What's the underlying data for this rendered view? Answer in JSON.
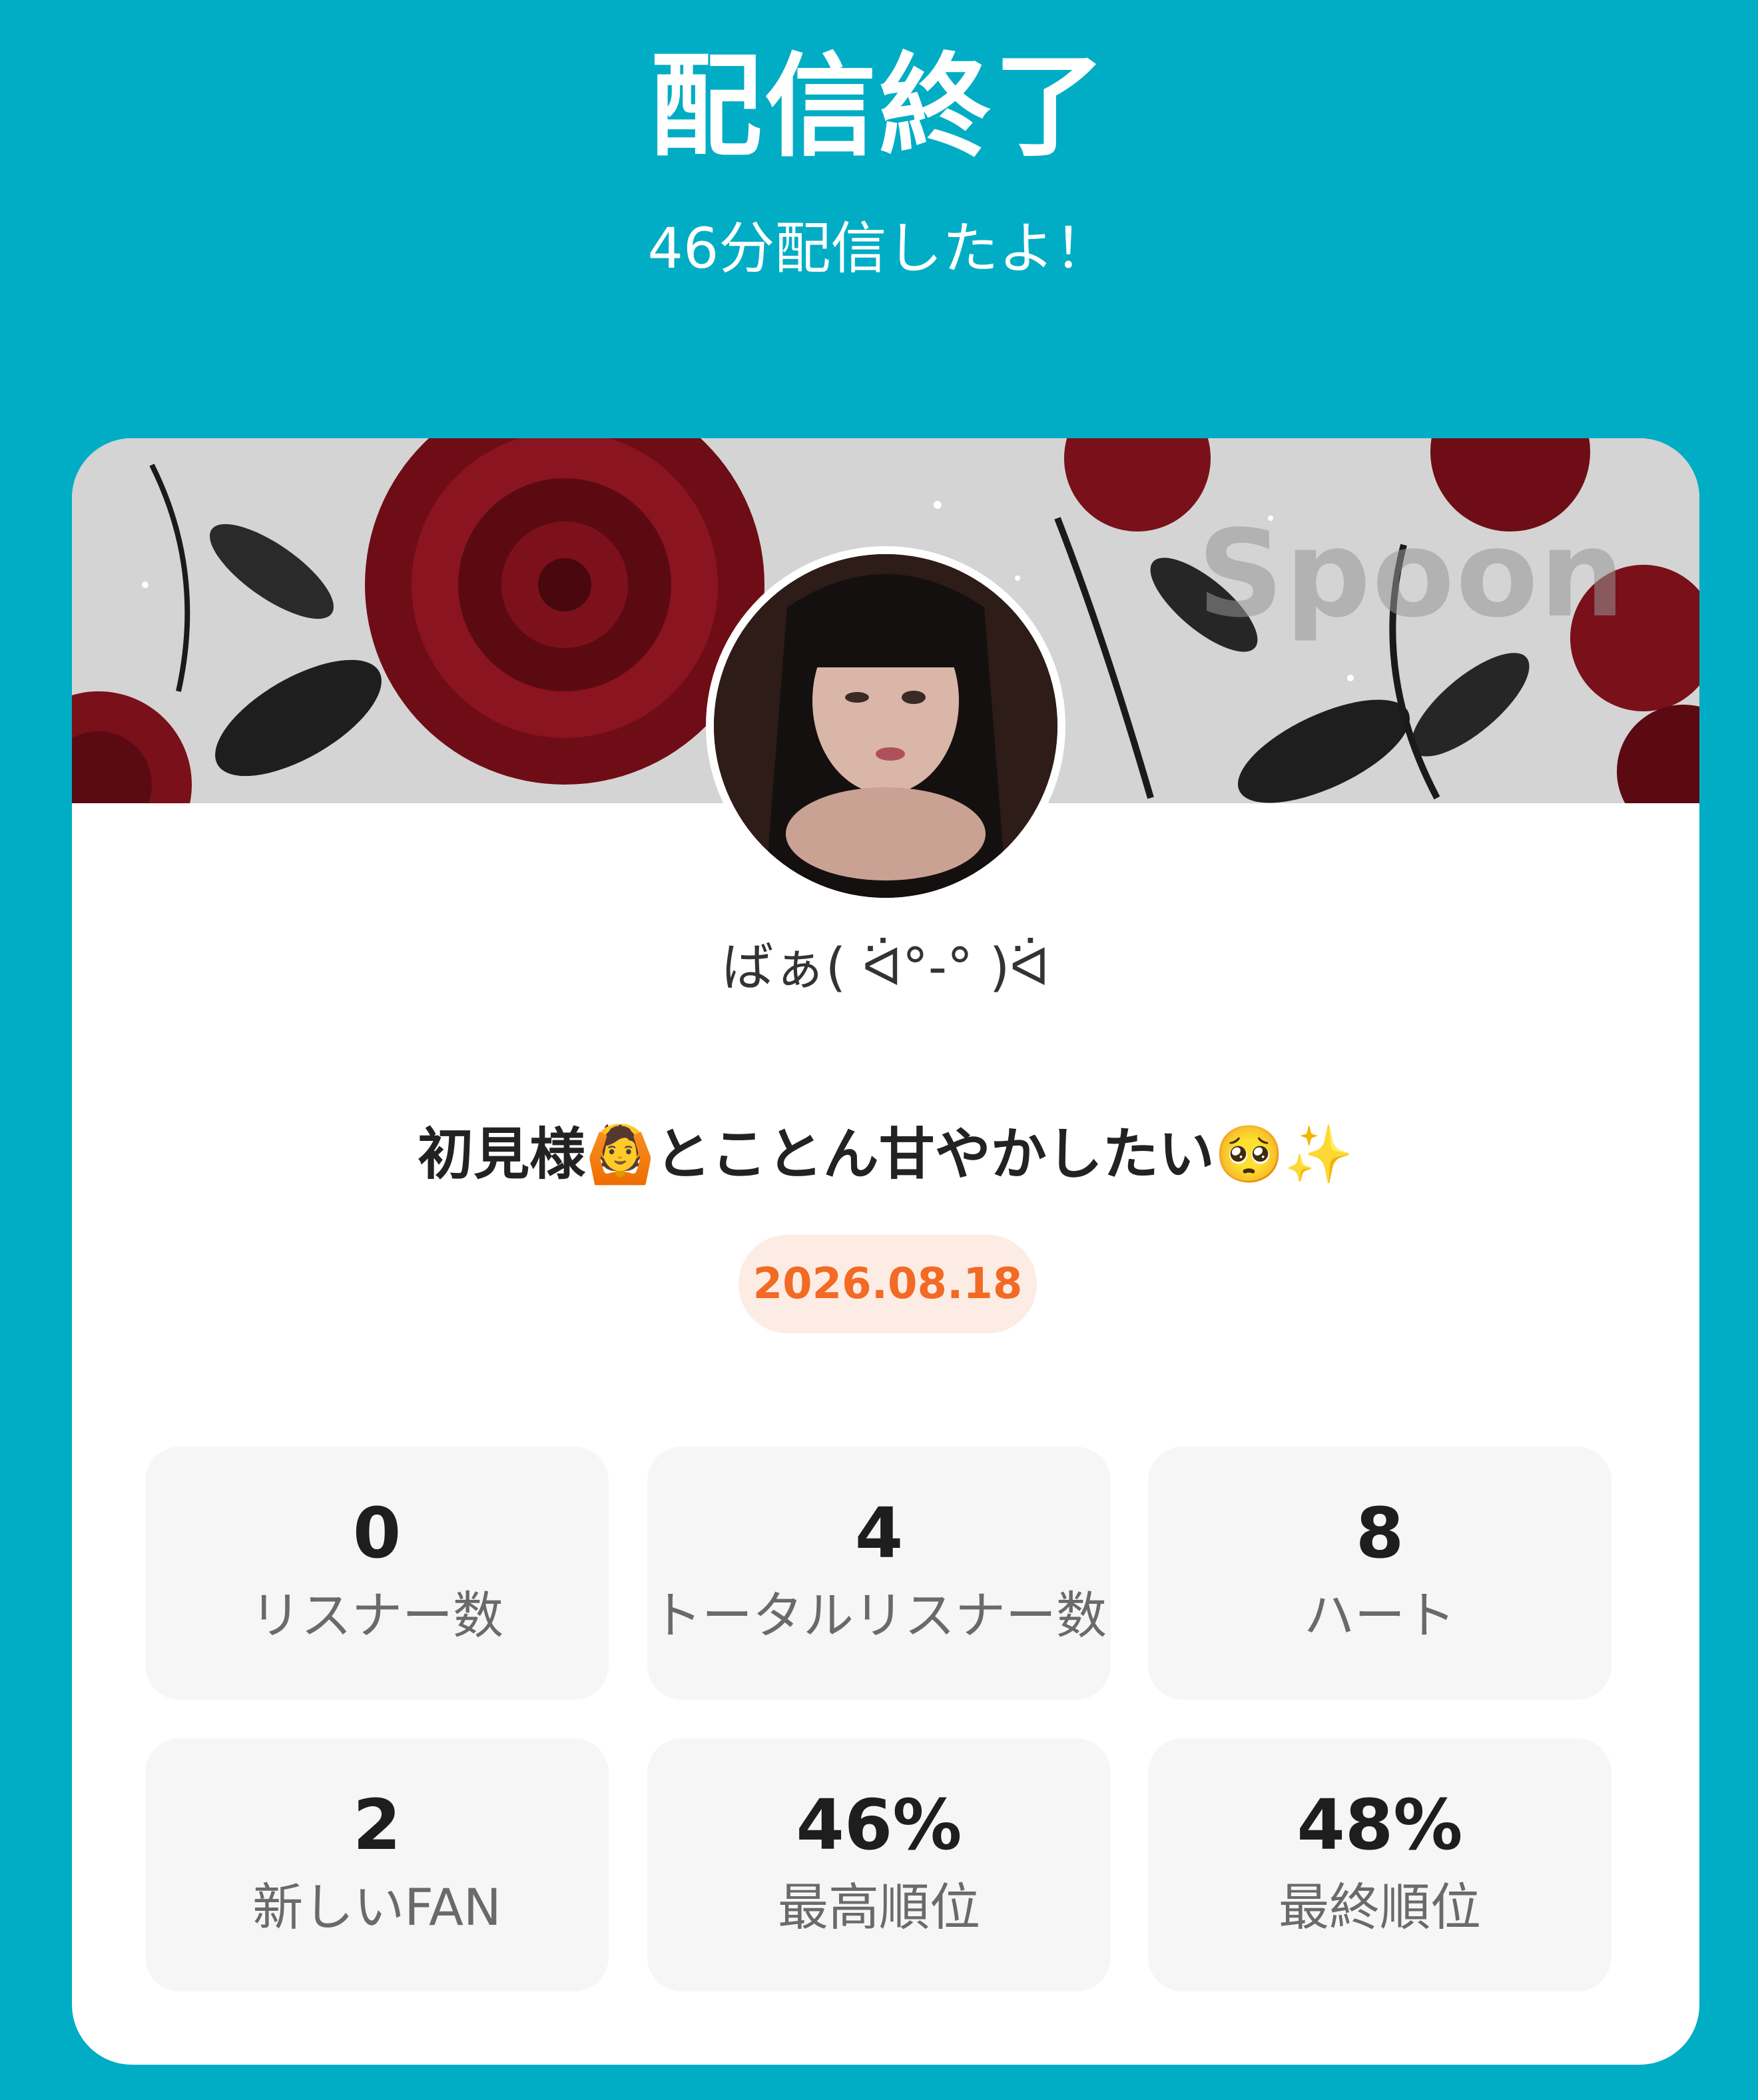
{
  "header": {
    "title": "配信終了",
    "subtitle": "46分配信したよ！"
  },
  "card": {
    "banner_watermark": "Spoon",
    "username": "ばぁ( ᐛ°-° )ᐛ",
    "stream_title": "初見様🙆とことん甘やかしたい🥺✨",
    "date": "2026.08.18",
    "stats": [
      {
        "value": "0",
        "label": "リスナー数"
      },
      {
        "value": "4",
        "label": "トータルリスナー数"
      },
      {
        "value": "8",
        "label": "ハート"
      },
      {
        "value": "2",
        "label": "新しいFAN"
      },
      {
        "value": "46%",
        "label": "最高順位"
      },
      {
        "value": "48%",
        "label": "最終順位"
      }
    ]
  },
  "colors": {
    "background": "#00adc4",
    "date_text": "#f26a24",
    "date_bg": "#fdece4"
  }
}
